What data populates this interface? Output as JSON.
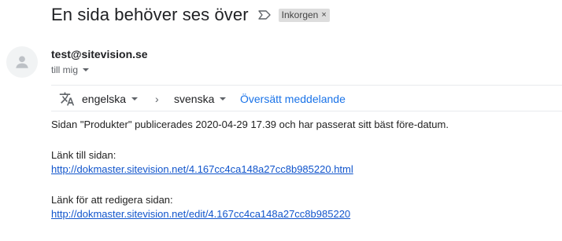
{
  "email": {
    "subject": "En sida behöver ses över",
    "label": "Inkorgen",
    "label_close": "×",
    "sender": "test@sitevision.se",
    "recipient": "till mig"
  },
  "translate": {
    "from_lang": "engelska",
    "arrow": "›",
    "to_lang": "svenska",
    "translate_link": "Översätt meddelande"
  },
  "body": {
    "line1": "Sidan \"Produkter\" publicerades 2020-04-29 17.39 och har passerat sitt bäst före-datum.",
    "link_page_label": "Länk till sidan:",
    "link_page_url": "http://dokmaster.sitevision.net/4.167cc4ca148a27cc8b985220.html",
    "link_edit_label": "Länk för att redigera sidan:",
    "link_edit_url": "http://dokmaster.sitevision.net/edit/4.167cc4ca148a27cc8b985220"
  },
  "icons": {
    "important": "important-marker-icon",
    "avatar": "person-icon",
    "translate": "translate-icon"
  }
}
